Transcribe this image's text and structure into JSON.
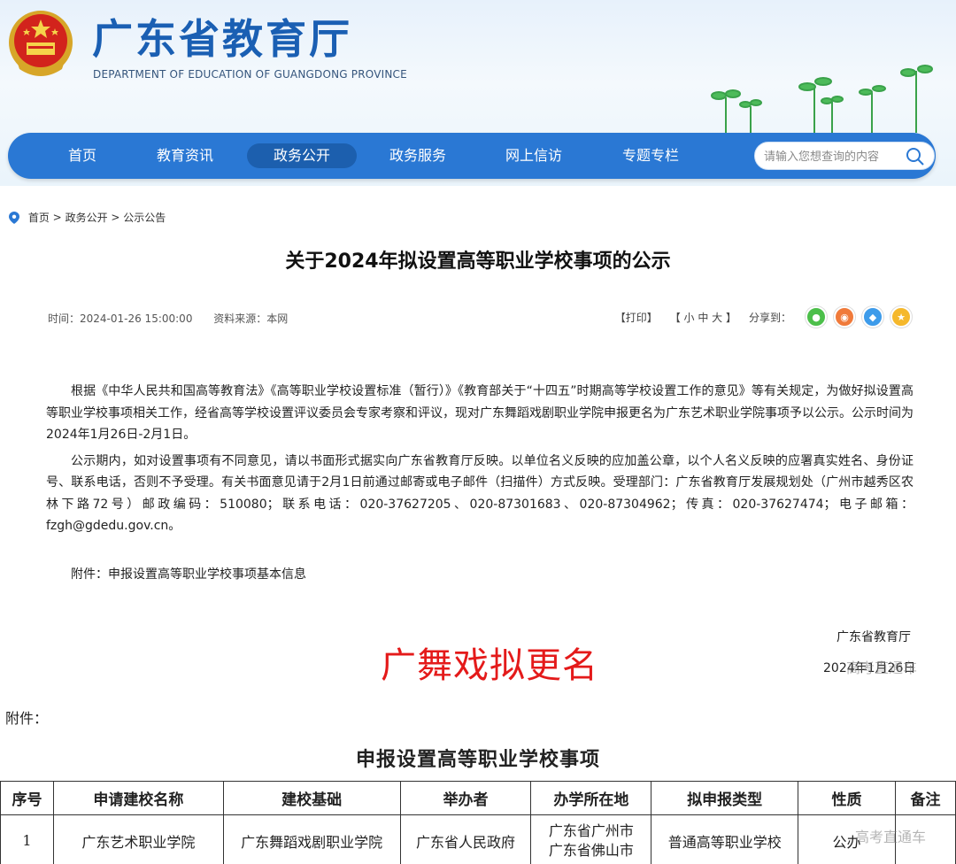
{
  "header": {
    "title": "广东省教育厅",
    "subtitle": "DEPARTMENT OF EDUCATION OF GUANGDONG PROVINCE"
  },
  "nav": {
    "items": [
      "首页",
      "教育资讯",
      "政务公开",
      "政务服务",
      "网上信访",
      "专题专栏"
    ],
    "active_index": 2,
    "search_placeholder": "请输入您想查询的内容"
  },
  "breadcrumb": [
    "首页",
    "政务公开",
    "公示公告"
  ],
  "breadcrumb_sep": ">",
  "article": {
    "title": "关于2024年拟设置高等职业学校事项的公示",
    "time": "时间：2024-01-26 15:00:00",
    "source": "资料来源：本网",
    "print": "【打印】",
    "font_size": "【 小  中  大 】",
    "share": "分享到：",
    "paragraphs": [
      "根据《中华人民共和国高等教育法》《高等职业学校设置标准（暂行）》《教育部关于“十四五”时期高等学校设置工作的意见》等有关规定，为做好拟设置高等职业学校事项相关工作，经省高等学校设置评议委员会专家考察和评议，现对广东舞蹈戏剧职业学院申报更名为广东艺术职业学院事项予以公示。公示时间为2024年1月26日-2月1日。",
      "公示期内，如对设置事项有不同意见，请以书面形式据实向广东省教育厅反映。以单位名义反映的应加盖公章，以个人名义反映的应署真实姓名、身份证号、联系电话，否则不予受理。有关书面意见请于2月1日前通过邮寄或电子邮件（扫描件）方式反映。受理部门：广东省教育厅发展规划处（广州市越秀区农林下路72号）邮政编码：510080；联系电话：020-37627205、020-87301683、020-87304962；传真：020-37627474；电子邮箱：fzgh@gdedu.gov.cn。"
    ],
    "attachment": "附件：申报设置高等职业学校事项基本信息",
    "sign_org": "广东省教育厅",
    "sign_date": "2024年1月26日",
    "watermark": "高考直通车"
  },
  "overlay_caption": "广舞戏拟更名",
  "attachment_section": {
    "label": "附件：",
    "table_title": "申报设置高等职业学校事项",
    "headers": [
      "序号",
      "申请建校名称",
      "建校基础",
      "举办者",
      "办学所在地",
      "拟申报类型",
      "性质",
      "备注"
    ],
    "rows": [
      [
        "1",
        "广东艺术职业学院",
        "广东舞蹈戏剧职业学院",
        "广东省人民政府",
        "广东省广州市\n广东省佛山市",
        "普通高等职业学校",
        "公办",
        ""
      ]
    ]
  },
  "colors": {
    "brand_blue": "#2a78d4",
    "title_blue": "#1a5fb3",
    "overlay_red": "#e41a1a"
  }
}
